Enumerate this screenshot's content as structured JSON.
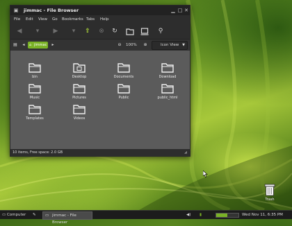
{
  "window": {
    "title": "jimmac - File Browser",
    "menu": [
      "File",
      "Edit",
      "View",
      "Go",
      "Bookmarks",
      "Tabs",
      "Help"
    ],
    "location": {
      "crumb": "jimmac",
      "zoom": "100%",
      "view_mode": "Icon View"
    },
    "files": [
      {
        "name": "bin",
        "icon": "folder-icon"
      },
      {
        "name": "Desktop",
        "icon": "desktop-folder-icon"
      },
      {
        "name": "Documents",
        "icon": "folder-icon"
      },
      {
        "name": "Download",
        "icon": "folder-icon"
      },
      {
        "name": "Music",
        "icon": "folder-icon"
      },
      {
        "name": "Pictures",
        "icon": "folder-icon"
      },
      {
        "name": "Public",
        "icon": "folder-icon"
      },
      {
        "name": "public_html",
        "icon": "folder-icon"
      },
      {
        "name": "Templates",
        "icon": "folder-icon"
      },
      {
        "name": "Videos",
        "icon": "folder-icon"
      }
    ],
    "status": "10 items, Free space: 2.0 GB"
  },
  "desktop": {
    "trash_label": "Trash"
  },
  "taskbar": {
    "computer_label": "Computer",
    "task_label": "jimmac - File Browser",
    "clock": "Wed Nov 11,  6:35 PM",
    "accent": "#7ab226",
    "meter_level": 0.5
  }
}
